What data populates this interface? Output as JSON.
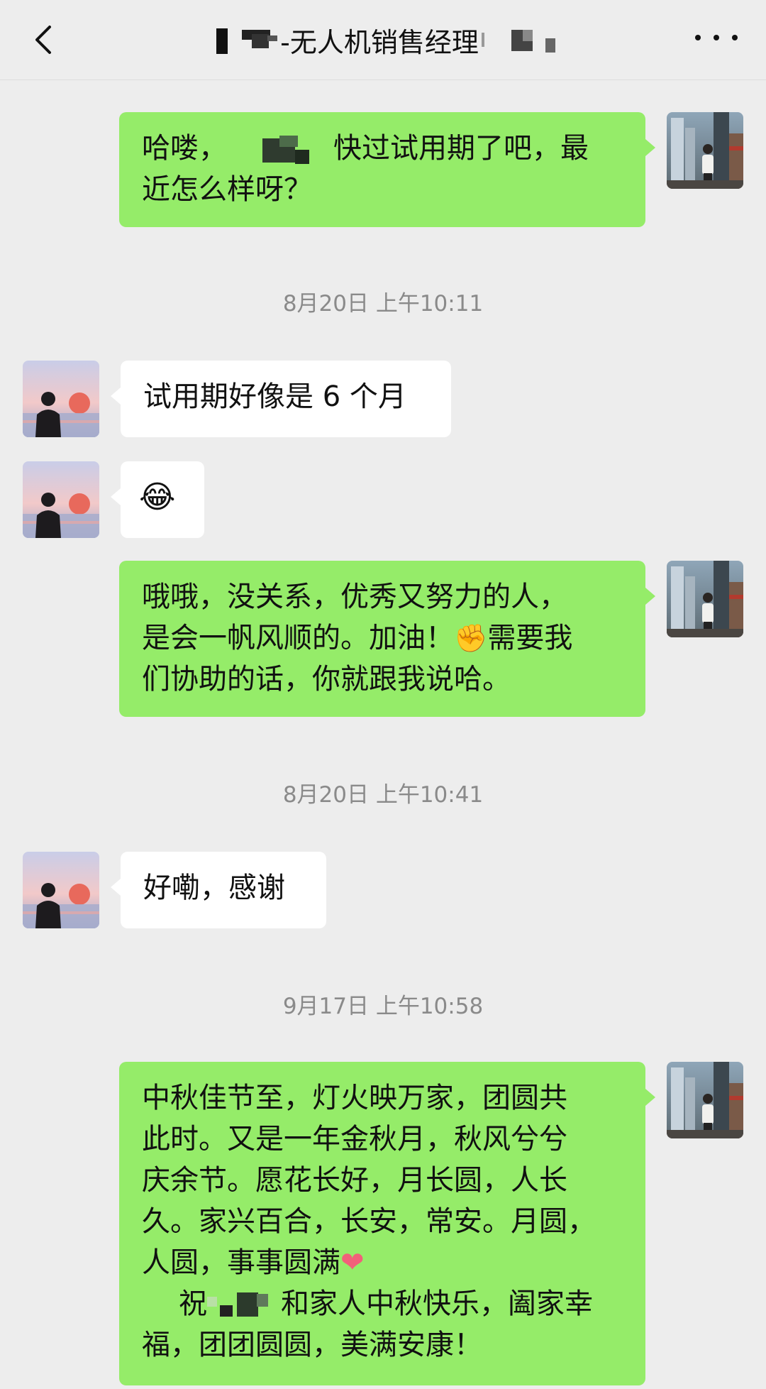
{
  "header": {
    "title": "-无人机销售经理",
    "back_icon": "chevron-left-icon",
    "more_icon": "more-dots-icon"
  },
  "messages": [
    {
      "side": "me",
      "text_a": "哈喽，",
      "text_b": "快过试用期了吧，最",
      "text_c": "近怎么样呀？"
    },
    {
      "timestamp": "8月20日 上午10:11"
    },
    {
      "side": "other",
      "text": "试用期好像是 6 个月"
    },
    {
      "side": "other",
      "emoji": "😂"
    },
    {
      "side": "me",
      "line1": "哦哦，没关系，优秀又努力的人，",
      "line2a": "是会一帆风顺的。加油！",
      "emoji": "✊",
      "line2b": "需要我",
      "line3": "们协助的话，你就跟我说哈。"
    },
    {
      "timestamp": "8月20日 上午10:41"
    },
    {
      "side": "other",
      "text": "好嘞，感谢"
    },
    {
      "timestamp": "9月17日 上午10:58"
    },
    {
      "side": "me",
      "line1": "中秋佳节至，灯火映万家，团圆共",
      "line2": "此时。又是一年金秋月，秋风兮兮",
      "line3": "庆余节。愿花长好，月长圆，人长",
      "line4": "久。家兴百合，长安，常安。月圆，",
      "line5": "人圆，事事圆满",
      "heart": "❤",
      "line6a": "祝",
      "line6b": "和家人中秋快乐，阖家幸",
      "line7": "福，团团圆圆，美满安康！"
    }
  ],
  "colors": {
    "self_bubble": "#95ec69",
    "other_bubble": "#ffffff",
    "background": "#ededed",
    "timestamp": "#8a8a8a"
  }
}
